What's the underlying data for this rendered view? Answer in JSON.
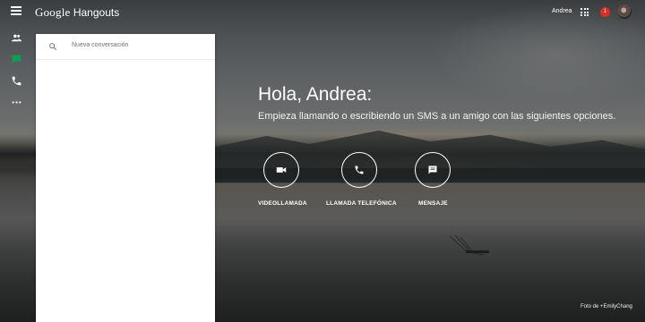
{
  "app": {
    "brand_google": "Google",
    "brand_product": "Hangouts",
    "user_name": "Andrea",
    "notification_count": "1"
  },
  "rail": {
    "items": [
      {
        "icon": "contacts-icon",
        "active": false
      },
      {
        "icon": "chat-icon",
        "active": true
      },
      {
        "icon": "phone-icon",
        "active": false
      },
      {
        "icon": "more-icon",
        "active": false
      }
    ]
  },
  "panel": {
    "search_placeholder": "Nueva conversación"
  },
  "main": {
    "greeting": "Hola, Andrea:",
    "subtitle": "Empieza llamando o escribiendo un SMS a un amigo con las siguientes opciones.",
    "actions": [
      {
        "label": "VIDEOLLAMADA",
        "icon": "video-camera-icon"
      },
      {
        "label": "LLAMADA TELEFÓNICA",
        "icon": "phone-icon"
      },
      {
        "label": "MENSAJE",
        "icon": "message-icon"
      }
    ],
    "photo_credit": "Foto de +EmilyChang"
  },
  "colors": {
    "accent_green": "#0f9d58",
    "notification_red": "#d93025"
  }
}
